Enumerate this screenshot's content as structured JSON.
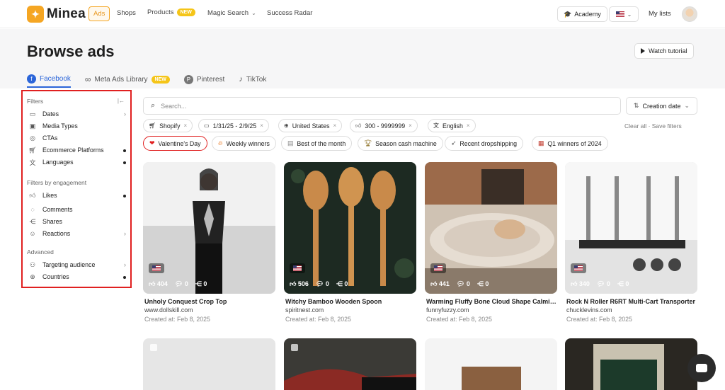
{
  "nav": {
    "brand": "Minea",
    "items": [
      {
        "label": "Ads",
        "active": true
      },
      {
        "label": "Shops"
      },
      {
        "label": "Products",
        "badge": "NEW"
      },
      {
        "label": "Magic Search"
      },
      {
        "label": "Success Radar"
      }
    ],
    "academy": "Academy",
    "my_lists": "My lists"
  },
  "page": {
    "title": "Browse ads",
    "watch_tutorial": "Watch tutorial"
  },
  "tabs": [
    {
      "label": "Facebook",
      "active": true
    },
    {
      "label": "Meta Ads Library",
      "badge": "NEW"
    },
    {
      "label": "Pinterest"
    },
    {
      "label": "TikTok"
    }
  ],
  "sidebar": {
    "filters_heading": "Filters",
    "filters": [
      {
        "label": "Dates",
        "icon": "calendar-icon",
        "trail": "chevron"
      },
      {
        "label": "Media Types",
        "icon": "media-icon",
        "trail": ""
      },
      {
        "label": "CTAs",
        "icon": "cta-icon",
        "trail": ""
      },
      {
        "label": "Ecommerce Platforms",
        "icon": "cart-icon",
        "trail": "dot"
      },
      {
        "label": "Languages",
        "icon": "translate-icon",
        "trail": "dot"
      }
    ],
    "engagement_heading": "Filters by engagement",
    "engagement": [
      {
        "label": "Likes",
        "icon": "thumb-icon",
        "trail": "dot"
      },
      {
        "label": "Comments",
        "icon": "comment-icon",
        "trail": ""
      },
      {
        "label": "Shares",
        "icon": "share-icon",
        "trail": ""
      },
      {
        "label": "Reactions",
        "icon": "smiley-icon",
        "trail": "chevron"
      }
    ],
    "advanced_heading": "Advanced",
    "advanced": [
      {
        "label": "Targeting audience",
        "icon": "person-icon",
        "trail": "chevron"
      },
      {
        "label": "Countries",
        "icon": "globe-icon",
        "trail": "dot"
      }
    ]
  },
  "search": {
    "placeholder": "Search...",
    "sort_label": "Creation date"
  },
  "active_filters": [
    {
      "label": "Shopify",
      "icon": "cart-icon"
    },
    {
      "label": "1/31/25 - 2/9/25",
      "icon": "calendar-icon"
    },
    {
      "label": "United States",
      "icon": "globe-icon"
    },
    {
      "label": "300 - 9999999",
      "icon": "thumb-icon"
    },
    {
      "label": "English",
      "icon": "translate-icon"
    }
  ],
  "clear_all": "Clear all",
  "save_filters": "Save filters",
  "presets": [
    {
      "label": "Valentine's Day",
      "icon": "heart-icon",
      "selected": true
    },
    {
      "label": "Weekly winners",
      "icon": "fire-icon"
    },
    {
      "label": "Best of the month",
      "icon": "chart-icon"
    },
    {
      "label": "Season cash machine",
      "icon": "trophy-icon"
    },
    {
      "label": "Recent dropshipping",
      "icon": "rocket-icon"
    },
    {
      "label": "Q1 winners of 2024",
      "icon": "calendar-icon"
    }
  ],
  "ads": [
    {
      "title": "Unholy Conquest Crop Top",
      "domain": "www.dollskill.com",
      "created": "Created at: Feb 8, 2025",
      "likes": "404",
      "comments": "0",
      "shares": "0",
      "color": "#f1f1f1"
    },
    {
      "title": "Witchy Bamboo Wooden Spoon",
      "domain": "spiritnest.com",
      "created": "Created at: Feb 8, 2025",
      "likes": "506",
      "comments": "0",
      "shares": "0",
      "color": "#1d2a22"
    },
    {
      "title": "Warming Fluffy Bone Cloud Shape Calming Be...",
      "domain": "funnyfuzzy.com",
      "created": "Created at: Feb 8, 2025",
      "likes": "441",
      "comments": "0",
      "shares": "0",
      "color": "#c9b8a6"
    },
    {
      "title": "Rock N Roller R6RT Multi-Cart Transporter",
      "domain": "chucklevins.com",
      "created": "Created at: Feb 8, 2025",
      "likes": "340",
      "comments": "0",
      "shares": "0",
      "color": "#f7f7f7"
    }
  ],
  "row2_colors": [
    "#e6e6e6",
    "#3b3a36",
    "#f4f4f4",
    "#2a2722"
  ]
}
